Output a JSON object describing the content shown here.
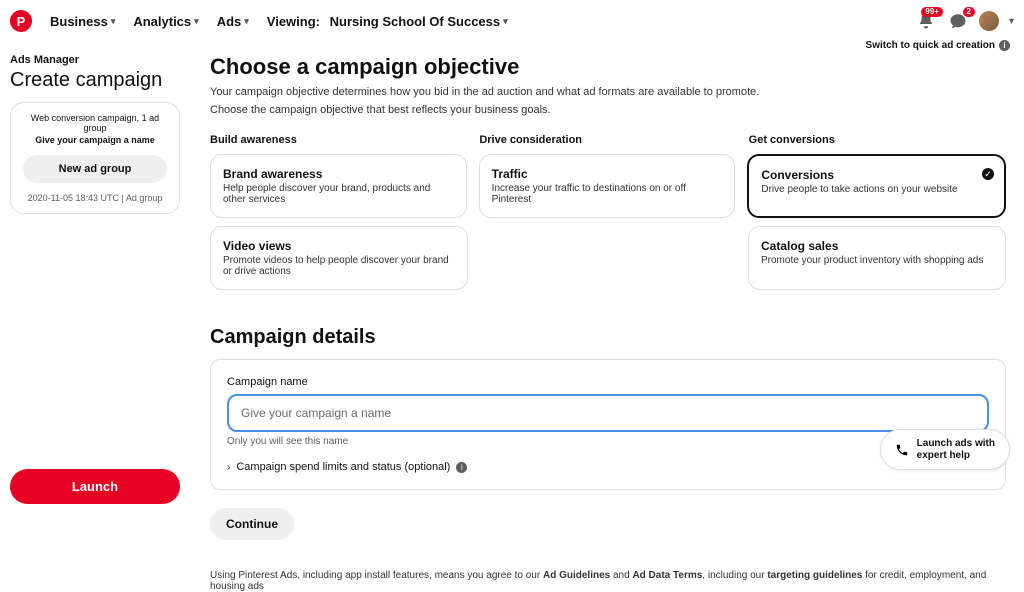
{
  "header": {
    "nav": [
      "Business",
      "Analytics",
      "Ads"
    ],
    "viewing_prefix": "Viewing:",
    "account": "Nursing School Of Success",
    "notif1": "99+",
    "notif2": "2",
    "quick_switch": "Switch to quick ad creation"
  },
  "side": {
    "bc": "Ads Manager",
    "title": "Create campaign",
    "meta": "Web conversion campaign, 1 ad group",
    "name": "Give your campaign a name",
    "btn": "New ad group",
    "ts": "2020-11-05 18:43 UTC  |  Ad group"
  },
  "objective": {
    "h1": "Choose a campaign objective",
    "sub1": "Your campaign objective determines how you bid in the ad auction and what ad formats are available to promote.",
    "sub2": "Choose the campaign objective that best reflects your business goals.",
    "cols": [
      "Build awareness",
      "Drive consideration",
      "Get conversions"
    ],
    "cards": {
      "brand": {
        "t": "Brand awareness",
        "d": "Help people discover your brand, products and other services"
      },
      "traffic": {
        "t": "Traffic",
        "d": "Increase your traffic to destinations on or off Pinterest"
      },
      "conv": {
        "t": "Conversions",
        "d": "Drive people to take actions on your website"
      },
      "video": {
        "t": "Video views",
        "d": "Promote videos to help people discover your brand or drive actions"
      },
      "catalog": {
        "t": "Catalog sales",
        "d": "Promote your product inventory with shopping ads"
      }
    }
  },
  "details": {
    "h2": "Campaign details",
    "label": "Campaign name",
    "placeholder": "Give your campaign a name",
    "hint": "Only you will see this name",
    "expander": "Campaign spend limits and status (optional)"
  },
  "actions": {
    "continue": "Continue",
    "launch": "Launch",
    "help_l1": "Launch ads with",
    "help_l2": "expert help"
  },
  "footer": {
    "pre": "Using Pinterest Ads, including app install features, means you agree to our ",
    "a1": "Ad Guidelines",
    "mid": " and ",
    "a2": "Ad Data Terms",
    "post1": ", including our ",
    "a3": "targeting guidelines",
    "post2": " for credit, employment, and housing ads"
  }
}
